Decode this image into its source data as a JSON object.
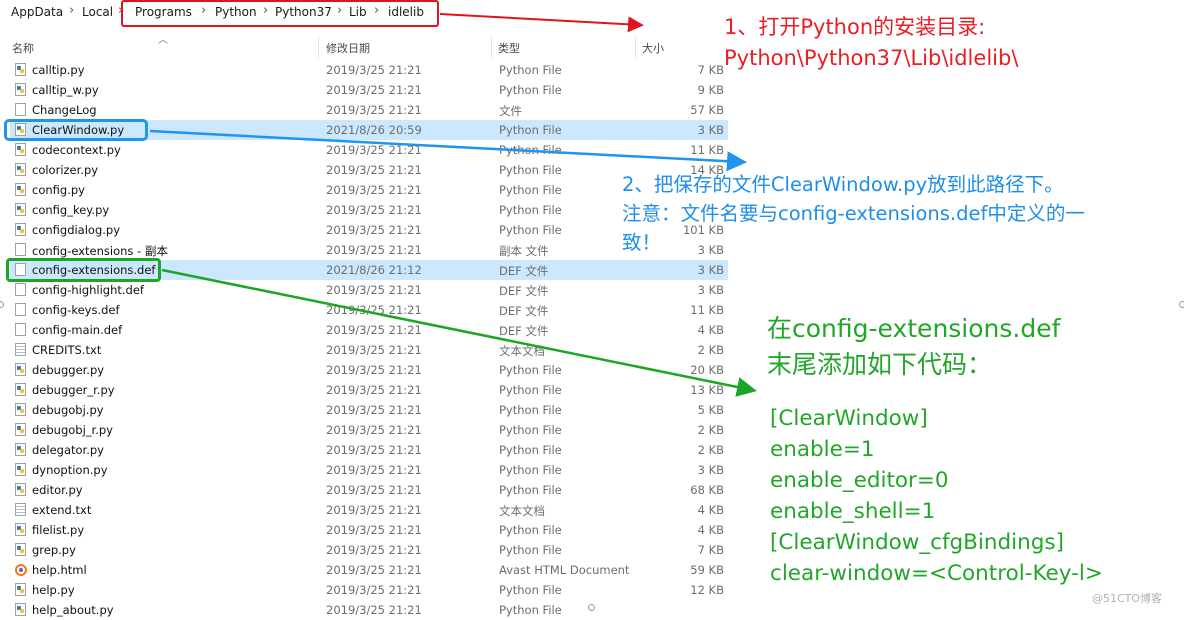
{
  "breadcrumb": {
    "items": [
      "AppData",
      "Local",
      "Programs",
      "Python",
      "Python37",
      "Lib",
      "idlelib"
    ],
    "separator": "›"
  },
  "columns": {
    "name": "名称",
    "date": "修改日期",
    "type": "类型",
    "size": "大小"
  },
  "files": [
    {
      "name": "calltip.py",
      "date": "2019/3/25 21:21",
      "type": "Python File",
      "size": "7 KB",
      "icon": "python-file-icon"
    },
    {
      "name": "calltip_w.py",
      "date": "2019/3/25 21:21",
      "type": "Python File",
      "size": "9 KB",
      "icon": "python-file-icon"
    },
    {
      "name": "ChangeLog",
      "date": "2019/3/25 21:21",
      "type": "文件",
      "size": "57 KB",
      "icon": "file-icon"
    },
    {
      "name": "ClearWindow.py",
      "date": "2021/8/26 20:59",
      "type": "Python File",
      "size": "3 KB",
      "icon": "python-file-icon",
      "selected": true
    },
    {
      "name": "codecontext.py",
      "date": "2019/3/25 21:21",
      "type": "Python File",
      "size": "11 KB",
      "icon": "python-file-icon"
    },
    {
      "name": "colorizer.py",
      "date": "2019/3/25 21:21",
      "type": "Python File",
      "size": "14 KB",
      "icon": "python-file-icon"
    },
    {
      "name": "config.py",
      "date": "2019/3/25 21:21",
      "type": "Python File",
      "size": "",
      "icon": "python-file-icon"
    },
    {
      "name": "config_key.py",
      "date": "2019/3/25 21:21",
      "type": "Python File",
      "size": "",
      "icon": "python-file-icon"
    },
    {
      "name": "configdialog.py",
      "date": "2019/3/25 21:21",
      "type": "Python File",
      "size": "101 KB",
      "icon": "python-file-icon"
    },
    {
      "name": "config-extensions - 副本",
      "date": "2019/3/25 21:21",
      "type": "副本 文件",
      "size": "3 KB",
      "icon": "file-icon"
    },
    {
      "name": "config-extensions.def",
      "date": "2021/8/26 21:12",
      "type": "DEF 文件",
      "size": "3 KB",
      "icon": "file-icon",
      "selected": true
    },
    {
      "name": "config-highlight.def",
      "date": "2019/3/25 21:21",
      "type": "DEF 文件",
      "size": "3 KB",
      "icon": "file-icon"
    },
    {
      "name": "config-keys.def",
      "date": "2019/3/25 21:21",
      "type": "DEF 文件",
      "size": "11 KB",
      "icon": "file-icon"
    },
    {
      "name": "config-main.def",
      "date": "2019/3/25 21:21",
      "type": "DEF 文件",
      "size": "4 KB",
      "icon": "file-icon"
    },
    {
      "name": "CREDITS.txt",
      "date": "2019/3/25 21:21",
      "type": "文本文档",
      "size": "2 KB",
      "icon": "text-file-icon"
    },
    {
      "name": "debugger.py",
      "date": "2019/3/25 21:21",
      "type": "Python File",
      "size": "20 KB",
      "icon": "python-file-icon"
    },
    {
      "name": "debugger_r.py",
      "date": "2019/3/25 21:21",
      "type": "Python File",
      "size": "13 KB",
      "icon": "python-file-icon"
    },
    {
      "name": "debugobj.py",
      "date": "2019/3/25 21:21",
      "type": "Python File",
      "size": "5 KB",
      "icon": "python-file-icon"
    },
    {
      "name": "debugobj_r.py",
      "date": "2019/3/25 21:21",
      "type": "Python File",
      "size": "2 KB",
      "icon": "python-file-icon"
    },
    {
      "name": "delegator.py",
      "date": "2019/3/25 21:21",
      "type": "Python File",
      "size": "2 KB",
      "icon": "python-file-icon"
    },
    {
      "name": "dynoption.py",
      "date": "2019/3/25 21:21",
      "type": "Python File",
      "size": "3 KB",
      "icon": "python-file-icon"
    },
    {
      "name": "editor.py",
      "date": "2019/3/25 21:21",
      "type": "Python File",
      "size": "68 KB",
      "icon": "python-file-icon"
    },
    {
      "name": "extend.txt",
      "date": "2019/3/25 21:21",
      "type": "文本文档",
      "size": "4 KB",
      "icon": "text-file-icon"
    },
    {
      "name": "filelist.py",
      "date": "2019/3/25 21:21",
      "type": "Python File",
      "size": "4 KB",
      "icon": "python-file-icon"
    },
    {
      "name": "grep.py",
      "date": "2019/3/25 21:21",
      "type": "Python File",
      "size": "7 KB",
      "icon": "python-file-icon"
    },
    {
      "name": "help.html",
      "date": "2019/3/25 21:21",
      "type": "Avast HTML Document",
      "size": "59 KB",
      "icon": "avast-html-icon"
    },
    {
      "name": "help.py",
      "date": "2019/3/25 21:21",
      "type": "Python File",
      "size": "12 KB",
      "icon": "python-file-icon"
    },
    {
      "name": "help_about.py",
      "date": "2019/3/25 21:21",
      "type": "Python File",
      "size": "",
      "icon": "python-file-icon"
    }
  ],
  "annotations": {
    "step1": [
      "1、打开Python的安装目录:",
      "Python\\Python37\\Lib\\idlelib\\"
    ],
    "step2": [
      "2、把保存的文件ClearWindow.py放到此路径下。",
      "注意：文件名要与config-extensions.def中定义的一",
      "致！"
    ],
    "step3": [
      "在config-extensions.def",
      "末尾添加如下代码："
    ],
    "code": [
      "[ClearWindow]",
      "enable=1",
      "enable_editor=0",
      "enable_shell=1",
      "[ClearWindow_cfgBindings]",
      "clear-window=<Control-Key-l>"
    ]
  },
  "colors": {
    "red": "#ea1c24",
    "blue": "#1e8ee8",
    "green": "#22a62a",
    "selection": "#cce8ff"
  },
  "watermark": "@51CTO博客"
}
